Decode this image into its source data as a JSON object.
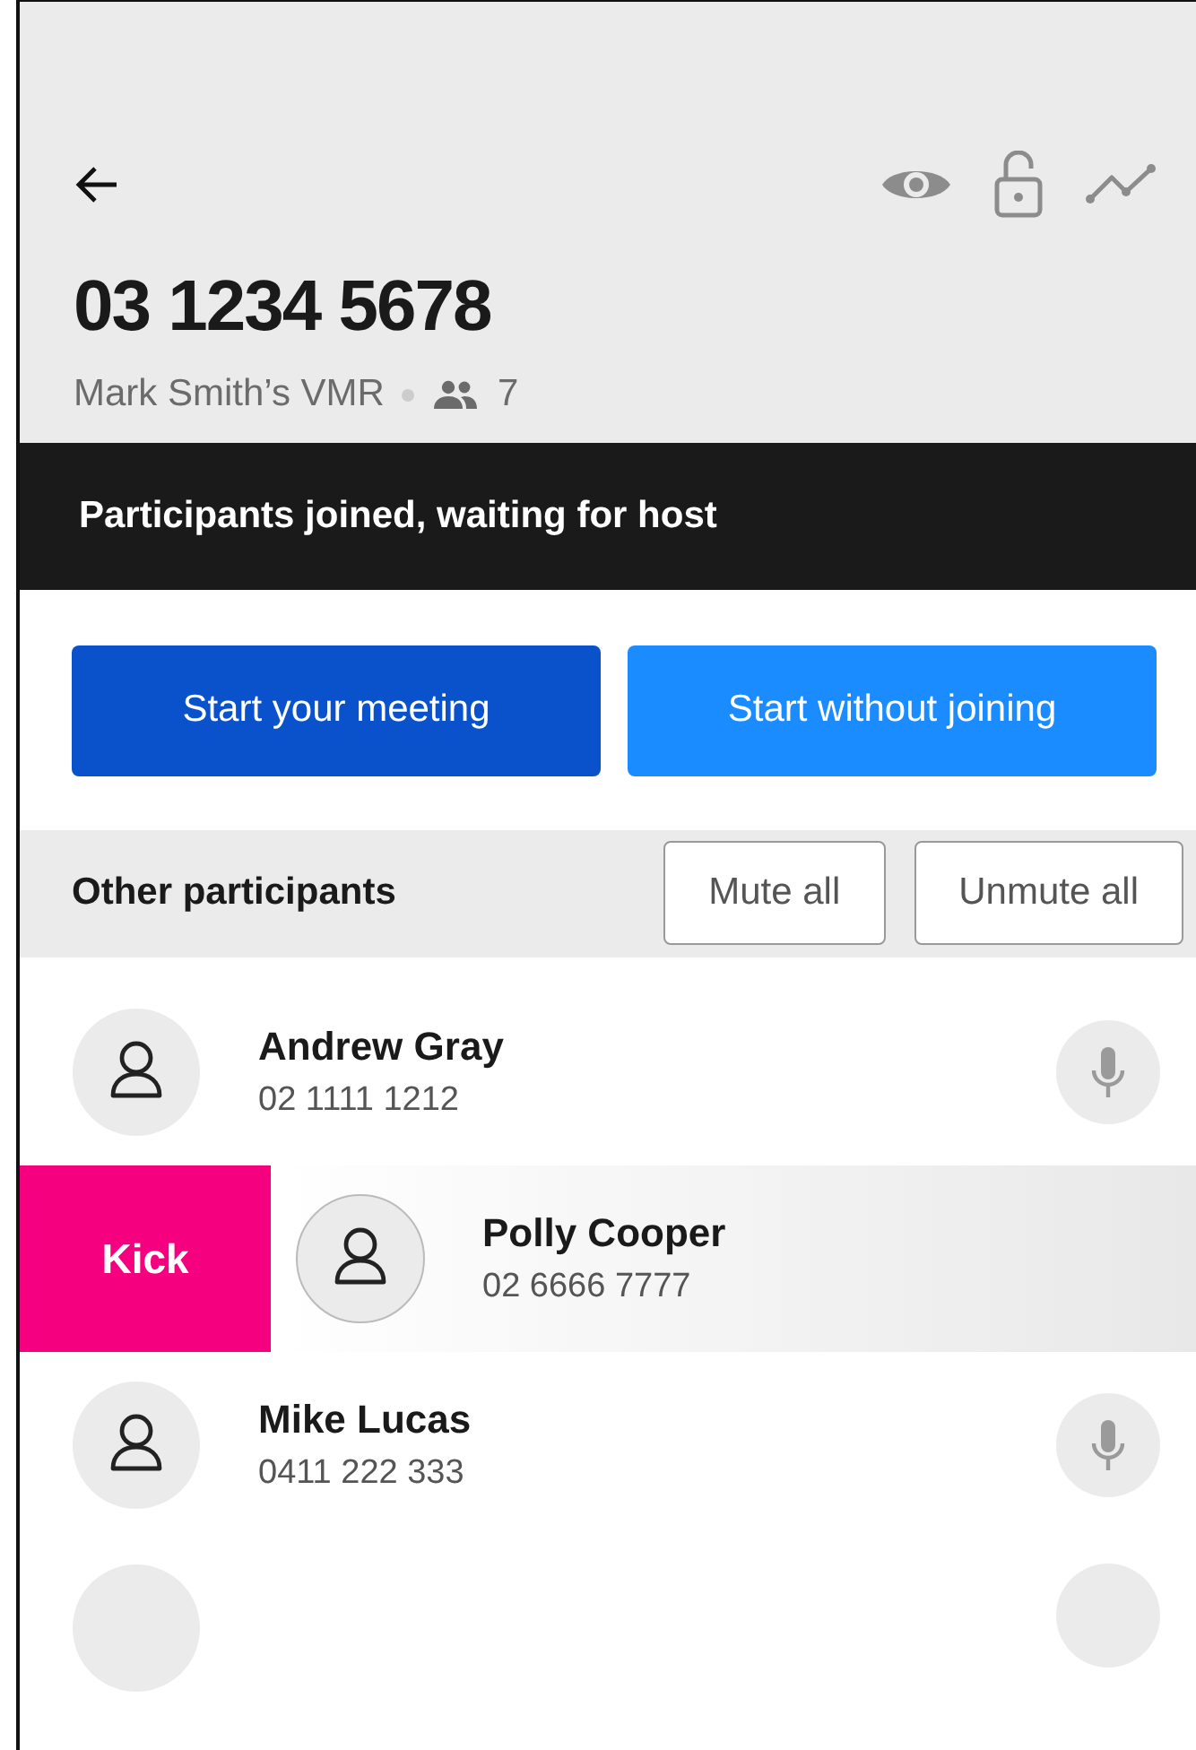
{
  "header": {
    "number": "03 1234 5678",
    "room": "Mark Smith’s VMR",
    "participant_count": "7"
  },
  "banner": {
    "text": "Participants joined, waiting for host"
  },
  "actions": [
    {
      "label": "Start your meeting",
      "kind": "primary"
    },
    {
      "label": "Start without joining",
      "kind": "secondary"
    }
  ],
  "participants_section": {
    "title": "Other participants",
    "buttons": [
      "Mute all",
      "Unmute all"
    ]
  },
  "participants": [
    {
      "name": "Andrew Gray",
      "number": "02 1111 1212",
      "swiped": false
    },
    {
      "name": "Polly Cooper",
      "number": "02 6666 7777",
      "swiped": true,
      "action": "Kick"
    },
    {
      "name": "Mike Lucas",
      "number": "0411 222 333",
      "swiped": false
    }
  ]
}
